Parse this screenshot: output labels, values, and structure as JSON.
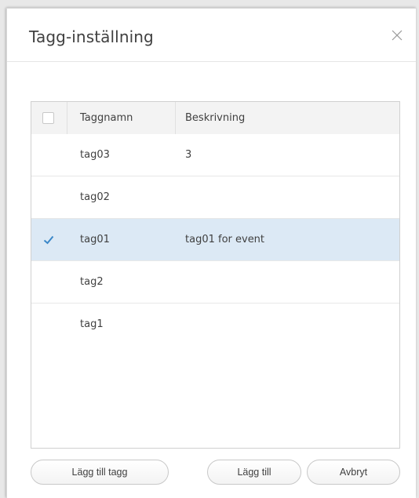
{
  "dialog": {
    "title": "Tagg-inställning",
    "close_icon": "close-icon"
  },
  "table": {
    "columns": [
      "Taggnamn",
      "Beskrivning"
    ],
    "select_all_checked": false,
    "rows": [
      {
        "name": "tag03",
        "description": "3",
        "checked": false
      },
      {
        "name": "tag02",
        "description": "",
        "checked": false
      },
      {
        "name": "tag01",
        "description": "tag01 for event",
        "checked": true
      },
      {
        "name": "tag2",
        "description": "",
        "checked": false
      },
      {
        "name": "tag1",
        "description": "",
        "checked": false
      }
    ]
  },
  "footer": {
    "add_tag_label": "Lägg till tagg",
    "add_label": "Lägg till",
    "cancel_label": "Avbryt"
  },
  "colors": {
    "selected_row": "#dce9f5",
    "check_color": "#3a87c8"
  }
}
